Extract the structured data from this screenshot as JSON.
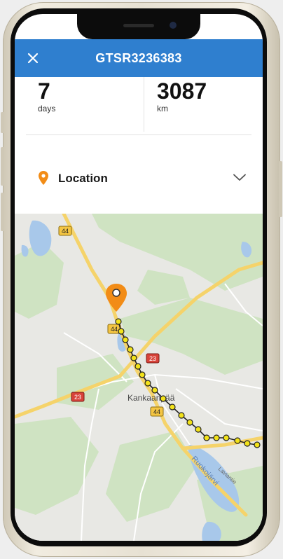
{
  "header": {
    "title": "GTSR3236383",
    "close_icon": "close-icon"
  },
  "stats": [
    {
      "value": "7",
      "unit": "days"
    },
    {
      "value": "3087",
      "unit": "km"
    }
  ],
  "location": {
    "label": "Location",
    "pin_icon": "location-pin-icon",
    "chevron_icon": "chevron-down-icon",
    "pin_color": "#f28c16"
  },
  "map": {
    "town_label": "Kankaanpää",
    "lake_label": "Ruokojärvi",
    "road_label_small": "Laviantie",
    "route_shields": [
      "44",
      "44",
      "44",
      "23",
      "23"
    ],
    "route_color": "#f2e21a"
  },
  "colors": {
    "header_bg": "#2f7fcf",
    "accent": "#f28c16"
  }
}
